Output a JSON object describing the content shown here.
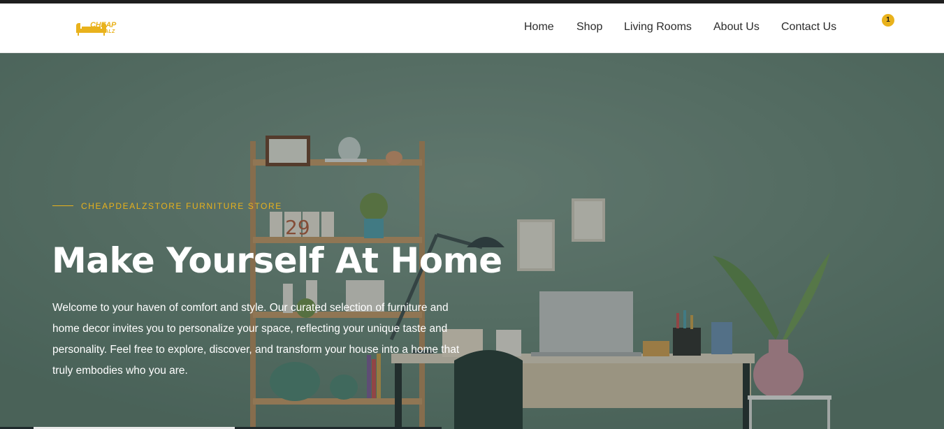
{
  "brand": {
    "logo_line1": "CHEAP",
    "logo_line2": "DEALZ",
    "accent_color": "#e9b21c"
  },
  "nav": {
    "items": [
      {
        "label": "Home"
      },
      {
        "label": "Shop"
      },
      {
        "label": "Living Rooms"
      },
      {
        "label": "About Us"
      },
      {
        "label": "Contact Us"
      }
    ],
    "cart": {
      "icon": "cart-icon",
      "count": "1"
    }
  },
  "hero": {
    "eyebrow": "CHEAPDEALZSTORE FURNITURE STORE",
    "title": "Make Yourself At Home",
    "body": "Welcome to your haven of comfort and style. Our curated selection of furniture and home decor invites you to personalize your space, reflecting your unique taste and personality. Feel free to explore, discover, and transform your house into a home that truly embodies who you are.",
    "calendar_digits": "29"
  }
}
